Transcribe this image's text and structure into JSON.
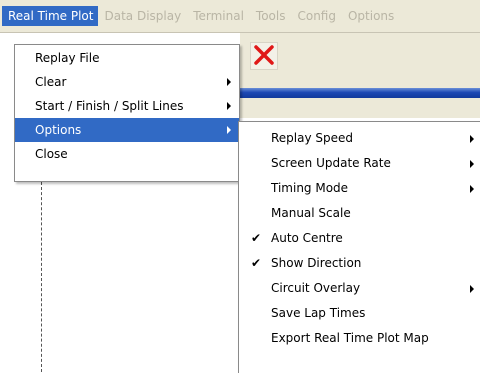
{
  "menubar": {
    "items": [
      "Real Time Plot",
      "Data Display",
      "Terminal",
      "Tools",
      "Config",
      "Options"
    ]
  },
  "main_menu": {
    "items": [
      {
        "label": "Replay File",
        "submenu": false
      },
      {
        "label": "Clear",
        "submenu": true
      },
      {
        "label": "Start / Finish / Split Lines",
        "submenu": true
      },
      {
        "label": "Options",
        "submenu": true
      },
      {
        "label": "Close",
        "submenu": false
      }
    ]
  },
  "options_menu": {
    "items": [
      {
        "label": "Replay Speed",
        "submenu": true,
        "checked": false
      },
      {
        "label": "Screen Update Rate",
        "submenu": true,
        "checked": false
      },
      {
        "label": "Timing Mode",
        "submenu": true,
        "checked": false
      },
      {
        "label": "Manual Scale",
        "submenu": false,
        "checked": false
      },
      {
        "label": "Auto Centre",
        "submenu": false,
        "checked": true
      },
      {
        "label": "Show Direction",
        "submenu": false,
        "checked": true
      },
      {
        "label": "Circuit Overlay",
        "submenu": true,
        "checked": false
      },
      {
        "label": "Save Lap Times",
        "submenu": false,
        "checked": false
      },
      {
        "label": "Export Real Time Plot Map",
        "submenu": false,
        "checked": false
      }
    ]
  },
  "colors": {
    "highlight": "#316ac5",
    "close_icon": "#e01818",
    "toolbar_bar": "#1c48b4"
  },
  "icons": {
    "toolbar_close": "close-icon",
    "check": "checkmark-icon"
  }
}
